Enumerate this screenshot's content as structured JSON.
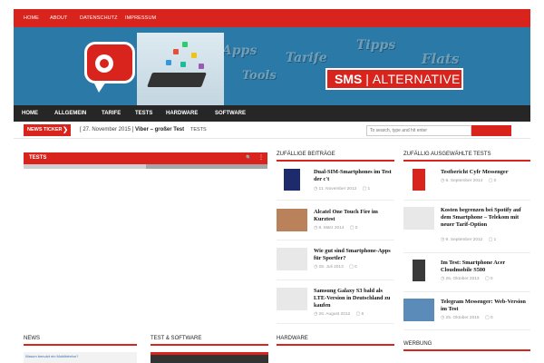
{
  "topnav": {
    "items": [
      "HOME",
      "ABOUT",
      "DATENSCHUTZ",
      "IMPRESSUM"
    ]
  },
  "header": {
    "brand_left": "SMS",
    "brand_sep": "|",
    "brand_right": "ALTERNATIVE",
    "bg_words": [
      "Apps",
      "Tarife",
      "Tipps",
      "Flats",
      "Tools"
    ]
  },
  "mainnav": {
    "items": [
      "HOME",
      "ALLGEMEIN",
      "TARIFE",
      "TESTS",
      "HARDWARE",
      "SOFTWARE"
    ]
  },
  "ticker": {
    "label": "NEWS TICKER",
    "chevron": "❯",
    "date": "[ 27. November 2015 ]",
    "title": "Viber – großer Test",
    "tag": "TESTS"
  },
  "search": {
    "placeholder": "To search, type and hit enter"
  },
  "slider": {
    "title": "TESTS",
    "search_icon": "🔍",
    "menu_icon": "⋮"
  },
  "random_posts": {
    "title": "ZUFÄLLIGE BEITRÄGE",
    "items": [
      {
        "title": "Dual-SIM-Smartphones im Test der c't",
        "date": "11. November 2012",
        "comments": "1"
      },
      {
        "title": "Alcatel One Touch Fire im Kurztest",
        "date": "8. März 2014",
        "comments": "0"
      },
      {
        "title": "Wie gut sind Smartphone-Apps für Sportler?",
        "date": "28. Juli 2013",
        "comments": "0"
      },
      {
        "title": "Samsung Galaxy S3 bald als LTE-Version in Deutschland zu kaufen",
        "date": "26. August 2012",
        "comments": "6"
      }
    ]
  },
  "random_tests": {
    "title": "ZUFÄLLIG AUSGEWÄHLTE TESTS",
    "items": [
      {
        "title": "Testbericht Cyfr Messenger",
        "date": "6. September 2014",
        "comments": "0"
      },
      {
        "title": "Kosten begrenzen bei Spotify auf dem Smartphone – Telekom mit neuer Tarif-Option",
        "date": "9. September 2012",
        "comments": "1"
      },
      {
        "title": "Im Test: Smartphone Acer Cloudmobile S500",
        "date": "26. Oktober 2013",
        "comments": "0"
      },
      {
        "title": "Telegram Messenger: Web-Version im Test",
        "date": "25. Oktober 2015",
        "comments": "0"
      }
    ]
  },
  "sections": {
    "news": "NEWS",
    "test_software": "TEST & SOFTWARE",
    "hardware": "HARDWARE",
    "werbung": "WERBUNG"
  },
  "news_thumb_text": "Warum benutzt ein Mobiltelefon?",
  "meta_icons": {
    "clock": "◷",
    "comment": "▢"
  },
  "colors": {
    "accent": "#d8241d",
    "banner": "#2a79a6",
    "nav": "#262626"
  }
}
